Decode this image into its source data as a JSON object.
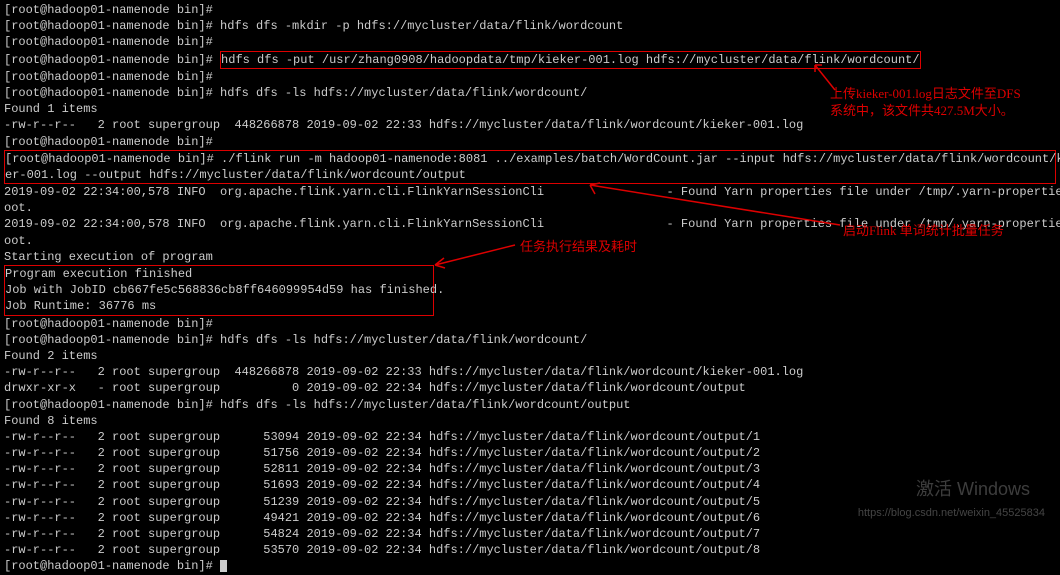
{
  "prompt": "[root@hadoop01-namenode bin]# ",
  "lines": {
    "l0": "[root@hadoop01-namenode bin]# ",
    "l1": "[root@hadoop01-namenode bin]# hdfs dfs -mkdir -p hdfs://mycluster/data/flink/wordcount",
    "l2": "[root@hadoop01-namenode bin]# ",
    "l3a": "[root@hadoop01-namenode bin]# ",
    "l3b": "hdfs dfs -put /usr/zhang0908/hadoopdata/tmp/kieker-001.log hdfs://mycluster/data/flink/wordcount/",
    "l4": "[root@hadoop01-namenode bin]# ",
    "l5": "[root@hadoop01-namenode bin]# hdfs dfs -ls hdfs://mycluster/data/flink/wordcount/",
    "l6": "Found 1 items",
    "l7": "-rw-r--r--   2 root supergroup  448266878 2019-09-02 22:33 hdfs://mycluster/data/flink/wordcount/kieker-001.log",
    "l8": "[root@hadoop01-namenode bin]# ",
    "l9a": "[root@hadoop01-namenode bin]# ./flink run -m hadoop01-namenode:8081 ../examples/batch/WordCount.jar --input hdfs://mycluster/data/flink/wordcount/kiek",
    "l9b": "er-001.log --output hdfs://mycluster/data/flink/wordcount/output",
    "l10": "2019-09-02 22:34:00,578 INFO  org.apache.flink.yarn.cli.FlinkYarnSessionCli                 - Found Yarn properties file under /tmp/.yarn-properties-r",
    "l11": "oot.",
    "l12": "2019-09-02 22:34:00,578 INFO  org.apache.flink.yarn.cli.FlinkYarnSessionCli                 - Found Yarn properties file under /tmp/.yarn-properties-r",
    "l13": "oot.",
    "l14": "Starting execution of program",
    "l15": "Program execution finished",
    "l16": "Job with JobID cb667fe5c568836cb8ff646099954d59 has finished.",
    "l17": "Job Runtime: 36776 ms",
    "l18": "[root@hadoop01-namenode bin]# ",
    "l19": "[root@hadoop01-namenode bin]# hdfs dfs -ls hdfs://mycluster/data/flink/wordcount/",
    "l20": "Found 2 items",
    "l21": "-rw-r--r--   2 root supergroup  448266878 2019-09-02 22:33 hdfs://mycluster/data/flink/wordcount/kieker-001.log",
    "l22": "drwxr-xr-x   - root supergroup          0 2019-09-02 22:34 hdfs://mycluster/data/flink/wordcount/output",
    "l23": "[root@hadoop01-namenode bin]# hdfs dfs -ls hdfs://mycluster/data/flink/wordcount/output",
    "l24": "Found 8 items",
    "l25": "-rw-r--r--   2 root supergroup      53094 2019-09-02 22:34 hdfs://mycluster/data/flink/wordcount/output/1",
    "l26": "-rw-r--r--   2 root supergroup      51756 2019-09-02 22:34 hdfs://mycluster/data/flink/wordcount/output/2",
    "l27": "-rw-r--r--   2 root supergroup      52811 2019-09-02 22:34 hdfs://mycluster/data/flink/wordcount/output/3",
    "l28": "-rw-r--r--   2 root supergroup      51693 2019-09-02 22:34 hdfs://mycluster/data/flink/wordcount/output/4",
    "l29": "-rw-r--r--   2 root supergroup      51239 2019-09-02 22:34 hdfs://mycluster/data/flink/wordcount/output/5",
    "l30": "-rw-r--r--   2 root supergroup      49421 2019-09-02 22:34 hdfs://mycluster/data/flink/wordcount/output/6",
    "l31": "-rw-r--r--   2 root supergroup      54824 2019-09-02 22:34 hdfs://mycluster/data/flink/wordcount/output/7",
    "l32": "-rw-r--r--   2 root supergroup      53570 2019-09-02 22:34 hdfs://mycluster/data/flink/wordcount/output/8",
    "l33": "[root@hadoop01-namenode bin]# "
  },
  "annotations": {
    "upload": "上传kieker-001.log日志文件至DFS",
    "upload2": "系统中，该文件共427.5M大小。",
    "result": "任务执行结果及耗时",
    "start": "启动Flink 单词统计批量任务"
  },
  "watermark": {
    "w1": "激活 Windows",
    "w2": "https://blog.csdn.net/weixin_45525834"
  }
}
